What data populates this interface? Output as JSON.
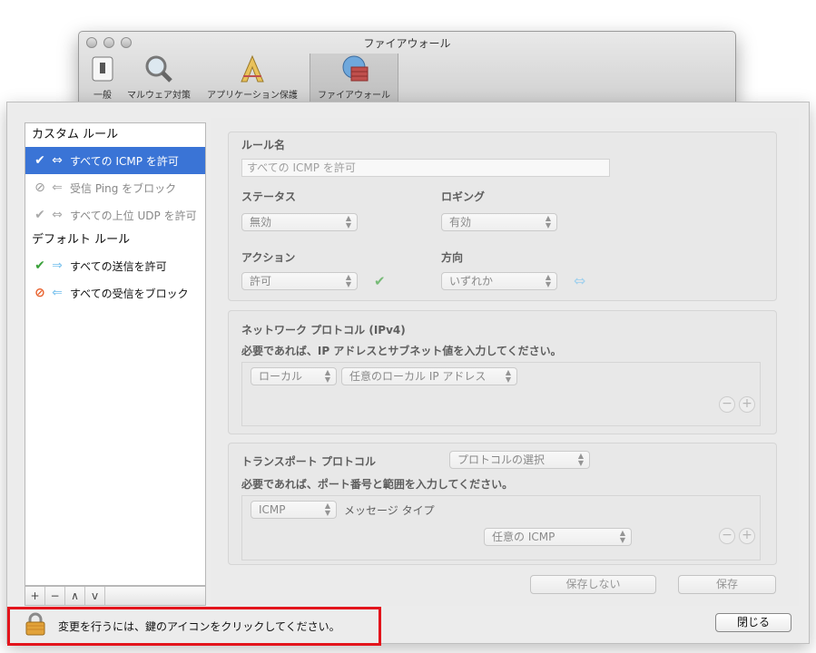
{
  "window": {
    "title": "ファイアウォール",
    "toolbar": [
      {
        "label": "一般",
        "icon": "switch-icon"
      },
      {
        "label": "マルウェア対策",
        "icon": "magnifier-icon"
      },
      {
        "label": "アプリケーション保護",
        "icon": "app-protection-icon"
      },
      {
        "label": "ファイアウォール",
        "icon": "firewall-globe-icon"
      }
    ]
  },
  "sidebar": {
    "custom_header": "カスタム ルール",
    "default_header": "デフォルト ルール",
    "custom_rules": [
      {
        "label": "すべての ICMP を許可"
      },
      {
        "label": "受信 Ping をブロック"
      },
      {
        "label": "すべての上位 UDP を許可"
      }
    ],
    "default_rules": [
      {
        "label": "すべての送信を許可"
      },
      {
        "label": "すべての受信をブロック"
      }
    ],
    "footer": {
      "add": "+",
      "remove": "−",
      "up": "∧",
      "down": "v"
    }
  },
  "rule": {
    "name_label": "ルール名",
    "name_value": "すべての ICMP を許可",
    "status_label": "ステータス",
    "status_value": "無効",
    "logging_label": "ロギング",
    "logging_value": "有効",
    "action_label": "アクション",
    "action_value": "許可",
    "direction_label": "方向",
    "direction_value": "いずれか"
  },
  "network": {
    "title": "ネットワーク プロトコル (IPv4)",
    "hint": "必要であれば、IP アドレスとサブネット値を入力してください。",
    "scope_value": "ローカル",
    "address_value": "任意のローカル IP アドレス",
    "remove": "−",
    "add": "+"
  },
  "transport": {
    "title": "トランスポート プロトコル",
    "protocol_select": "プロトコルの選択",
    "hint": "必要であれば、ポート番号と範囲を入力してください。",
    "proto_value": "ICMP",
    "message_type_label": "メッセージ タイプ",
    "icmp_value": "任意の ICMP",
    "remove": "−",
    "add": "+"
  },
  "buttons": {
    "dont_save": "保存しない",
    "save": "保存",
    "close": "閉じる"
  },
  "lock_message": "変更を行うには、鍵のアイコンをクリックしてください。",
  "colors": {
    "selection": "#3a74d6",
    "allow_green": "#3aa13a",
    "block_orange": "#e8602c",
    "arrow_blue": "#7ec4ee",
    "highlight_red": "#e3141c"
  }
}
